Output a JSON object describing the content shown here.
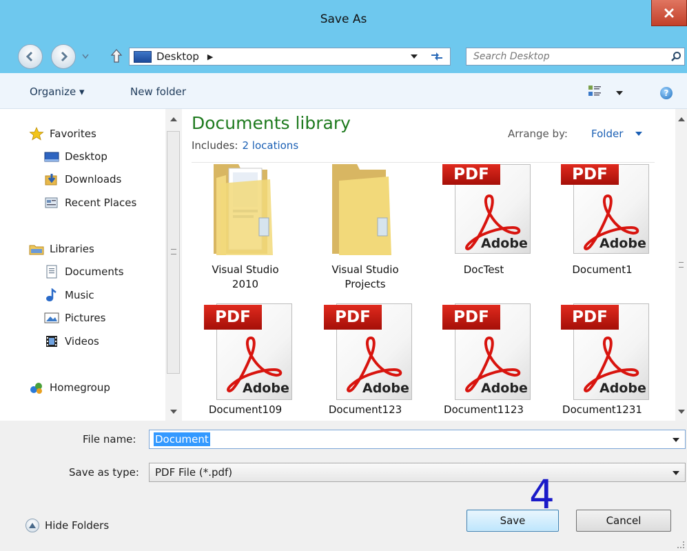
{
  "window": {
    "title": "Save As"
  },
  "address": {
    "location": "Desktop",
    "search_placeholder": "Search Desktop"
  },
  "toolbar": {
    "organize_label": "Organize ▾",
    "new_folder_label": "New folder",
    "help_label": "?"
  },
  "nav": {
    "favorites_label": "Favorites",
    "desktop_label": "Desktop",
    "downloads_label": "Downloads",
    "recent_label": "Recent Places",
    "libraries_label": "Libraries",
    "documents_label": "Documents",
    "music_label": "Music",
    "pictures_label": "Pictures",
    "videos_label": "Videos",
    "homegroup_label": "Homegroup"
  },
  "content": {
    "library_title": "Documents library",
    "includes_label": "Includes:",
    "includes_link": "2 locations",
    "arrange_label": "Arrange by:",
    "arrange_value": "Folder",
    "items": [
      {
        "name_line1": "Visual Studio",
        "name_line2": "2010",
        "kind": "folder"
      },
      {
        "name_line1": "Visual Studio",
        "name_line2": "Projects",
        "kind": "folder"
      },
      {
        "name_line1": "DocTest",
        "name_line2": "",
        "kind": "pdf"
      },
      {
        "name_line1": "Document1",
        "name_line2": "",
        "kind": "pdf"
      },
      {
        "name_line1": "Document109",
        "name_line2": "",
        "kind": "pdf"
      },
      {
        "name_line1": "Document123",
        "name_line2": "",
        "kind": "pdf"
      },
      {
        "name_line1": "Document1123",
        "name_line2": "",
        "kind": "pdf"
      },
      {
        "name_line1": "Document1231",
        "name_line2": "",
        "kind": "pdf"
      }
    ],
    "pdf_banner_text": "PDF",
    "pdf_brand_text": "Adobe"
  },
  "form": {
    "file_name_label": "File name:",
    "file_name_value": "Document",
    "save_type_label": "Save as type:",
    "save_type_value": "PDF File (*.pdf)"
  },
  "footer": {
    "hide_folders_label": "Hide Folders",
    "save_label": "Save",
    "cancel_label": "Cancel",
    "step_number": "4"
  },
  "colors": {
    "titlebar": "#6ec8ee",
    "library_title": "#1e7a1e",
    "link": "#1a5fb4",
    "close": "#c2402a",
    "selection": "#3399ff"
  }
}
